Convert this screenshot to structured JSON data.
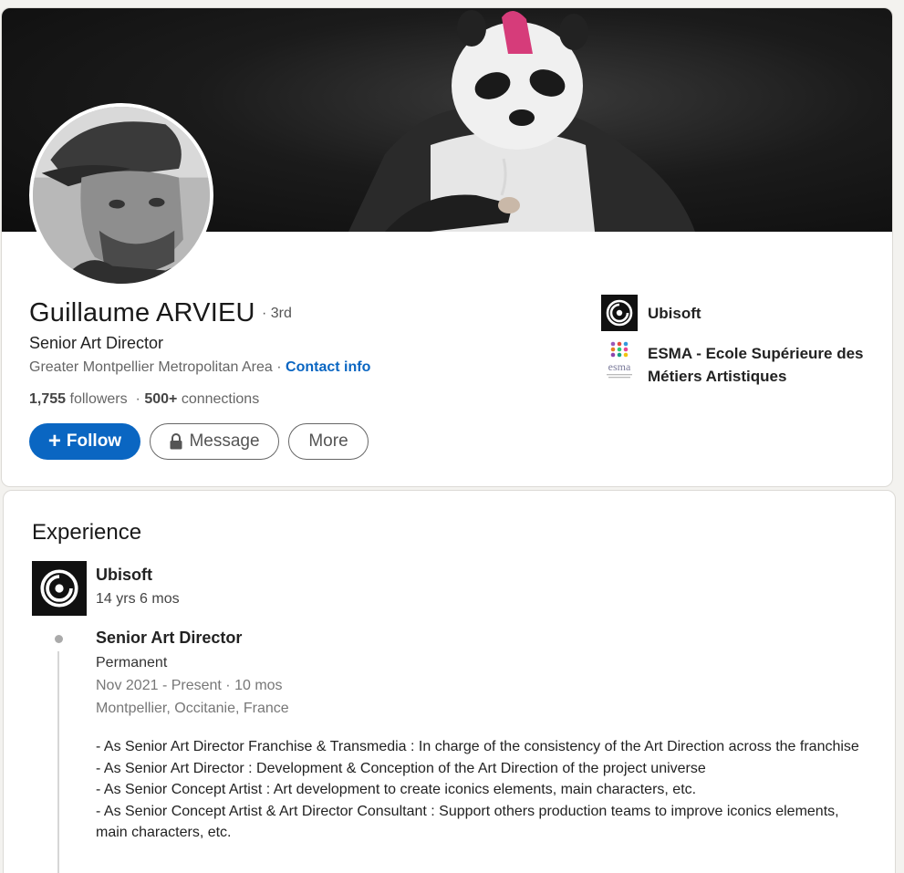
{
  "profile": {
    "name": "Guillaume ARVIEU",
    "degree": "· 3rd",
    "headline": "Senior Art Director",
    "location": "Greater Montpellier Metropolitan Area ·",
    "contact_info": "Contact info",
    "followers_count": "1,755",
    "followers_label": "followers",
    "connections_count": "500+",
    "connections_label": "connections",
    "separator": "·"
  },
  "actions": {
    "follow": "Follow",
    "message": "Message",
    "more": "More"
  },
  "top_card_companies": [
    {
      "name": "Ubisoft",
      "icon": "ubisoft-logo"
    },
    {
      "name": "ESMA - Ecole Supérieure des Métiers Artistiques",
      "icon": "esma-logo",
      "logo_text": "esma"
    }
  ],
  "experience": {
    "title": "Experience",
    "company": "Ubisoft",
    "duration": "14 yrs 6 mos",
    "role": {
      "title": "Senior Art Director",
      "type": "Permanent",
      "dates": "Nov 2021 - Present · 10 mos",
      "location": "Montpellier, Occitanie, France",
      "description": [
        "- As Senior Art Director Franchise & Transmedia : In charge of the consistency of the Art Direction across the franchise",
        "- As Senior Art Director : Development & Conception of the Art Direction of the project universe",
        "- As Senior Concept Artist : Art development to create iconics elements, main characters, etc.",
        "- As Senior Concept Artist & Art Director Consultant : Support others production teams to improve iconics elements, main characters, etc."
      ]
    }
  },
  "colors": {
    "primary": "#0a66c2",
    "background": "#f3f2ef",
    "mohawk": "#d63c7a"
  }
}
